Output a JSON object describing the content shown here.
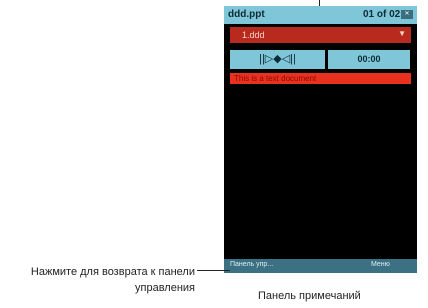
{
  "title_bar": {
    "file_name": "ddd.ppt",
    "page_indicator": "01 of 02",
    "close_icon": "close-icon"
  },
  "slide_select": {
    "value": "1.ddd",
    "icon": "chevron-down-icon"
  },
  "controls": {
    "audio_glyph": "||▷◆◁||",
    "time": "00:00"
  },
  "note": {
    "text": "This is a text document"
  },
  "softkeys": {
    "left": "Панель упр...",
    "right": "Меню"
  },
  "callouts": {
    "left_line1": "Нажмите для возврата к панели",
    "left_line2": "управления",
    "bottom": "Панель примечаний"
  },
  "colors": {
    "title_bar": "#7fc6d8",
    "slide_select": "#b82a1e",
    "note_bar": "#e8311f",
    "bottom_bar": "#3b7183",
    "screen": "#000000"
  }
}
